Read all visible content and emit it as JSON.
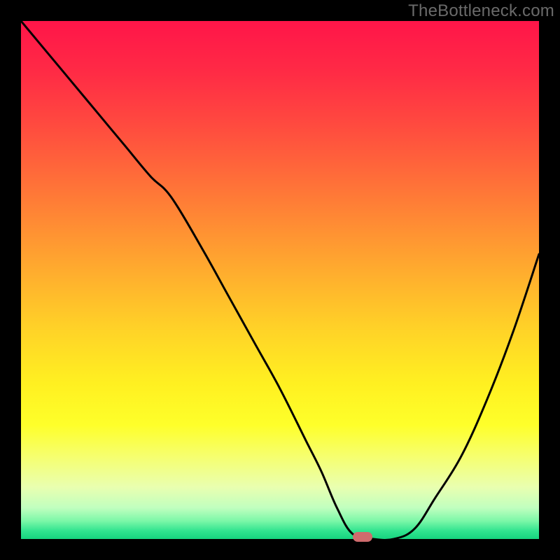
{
  "watermark": "TheBottleneck.com",
  "chart_data": {
    "type": "line",
    "title": "",
    "xlabel": "",
    "ylabel": "",
    "xlim": [
      0,
      100
    ],
    "ylim": [
      0,
      100
    ],
    "x": [
      0,
      5,
      10,
      15,
      20,
      25,
      29,
      35,
      40,
      45,
      50,
      55,
      58,
      61,
      64,
      68,
      72,
      76,
      80,
      85,
      90,
      95,
      100
    ],
    "values": [
      100,
      94,
      88,
      82,
      76,
      70,
      66,
      56,
      47,
      38,
      29,
      19,
      13,
      6,
      1,
      0,
      0,
      2,
      8,
      16,
      27,
      40,
      55
    ],
    "optimum_x": 66,
    "optimum_y": 0,
    "gradient_stops": [
      {
        "offset": 0.0,
        "color": "#ff1549"
      },
      {
        "offset": 0.1,
        "color": "#ff2b45"
      },
      {
        "offset": 0.2,
        "color": "#ff4a3f"
      },
      {
        "offset": 0.3,
        "color": "#ff6c39"
      },
      {
        "offset": 0.4,
        "color": "#ff8f33"
      },
      {
        "offset": 0.5,
        "color": "#ffb22d"
      },
      {
        "offset": 0.6,
        "color": "#ffd427"
      },
      {
        "offset": 0.7,
        "color": "#fff021"
      },
      {
        "offset": 0.78,
        "color": "#feff2a"
      },
      {
        "offset": 0.84,
        "color": "#f6ff6e"
      },
      {
        "offset": 0.9,
        "color": "#e9ffb0"
      },
      {
        "offset": 0.94,
        "color": "#c0ffbf"
      },
      {
        "offset": 0.965,
        "color": "#7cf7a8"
      },
      {
        "offset": 0.985,
        "color": "#2fe38f"
      },
      {
        "offset": 1.0,
        "color": "#17d47f"
      }
    ]
  }
}
